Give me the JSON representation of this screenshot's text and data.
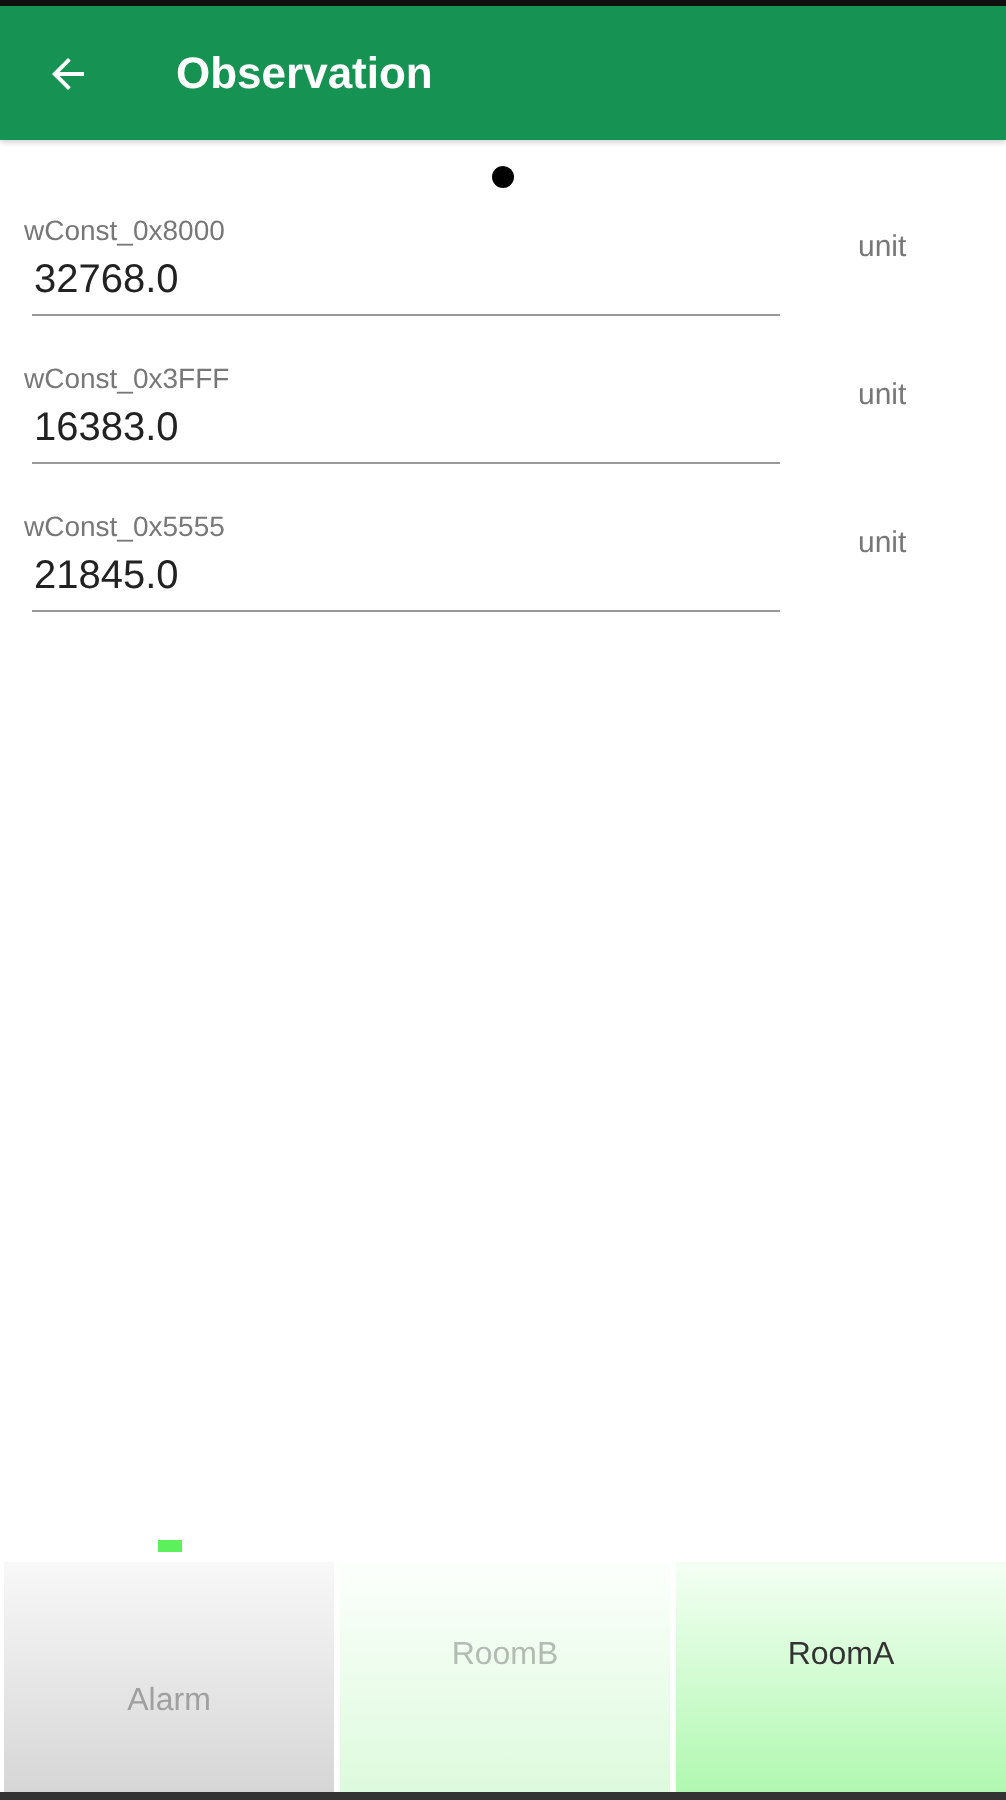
{
  "app_bar": {
    "title": "Observation"
  },
  "fields": [
    {
      "label": "wConst_0x8000",
      "value": "32768.0",
      "unit": "unit"
    },
    {
      "label": "wConst_0x3FFF",
      "value": "16383.0",
      "unit": "unit"
    },
    {
      "label": "wConst_0x5555",
      "value": "21845.0",
      "unit": "unit"
    }
  ],
  "bottom_tabs": [
    {
      "label": "Alarm",
      "kind": "alarm",
      "selected": false,
      "indicator": true
    },
    {
      "label": "RoomB",
      "kind": "room",
      "selected": false,
      "indicator": false
    },
    {
      "label": "RoomA",
      "kind": "room",
      "selected": true,
      "indicator": false
    }
  ]
}
